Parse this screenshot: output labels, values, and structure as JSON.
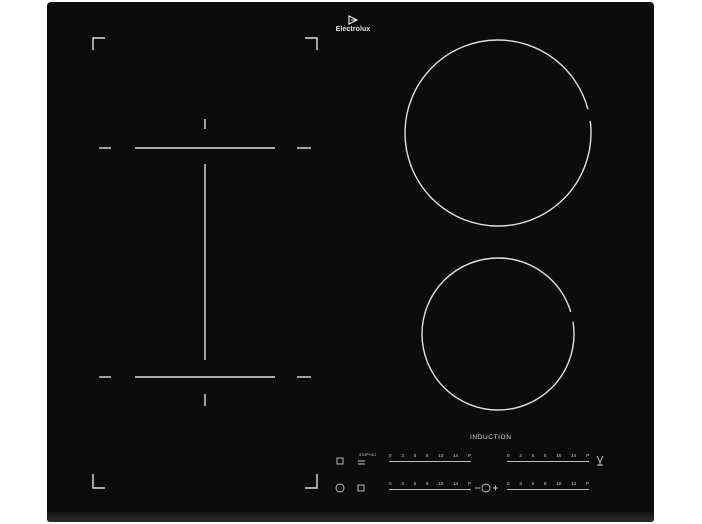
{
  "brand": {
    "name": "Electrolux",
    "logo_icon": "electrolux-logo-icon"
  },
  "colors": {
    "glass": "#0b0b0c",
    "markings": "#e0e0e0"
  },
  "label": {
    "induction": "INDUCTION"
  },
  "controls": {
    "power_icon": "power-icon",
    "lock_icon": "lock-icon",
    "stop_go_label": "STOP+GO",
    "stop_go_icon": "pause-icon",
    "bridge_icon": "bridge-icon",
    "hob2hood_icon": "hob2hood-icon",
    "timer_icon": "timer-icon",
    "minus_label": "–",
    "plus_label": "+",
    "scale": [
      "0",
      "3",
      "5",
      "8",
      "10",
      "14",
      "P"
    ]
  },
  "zones": [
    {
      "name": "left flexi bridge zone"
    },
    {
      "name": "right rear zone"
    },
    {
      "name": "right front zone"
    }
  ]
}
